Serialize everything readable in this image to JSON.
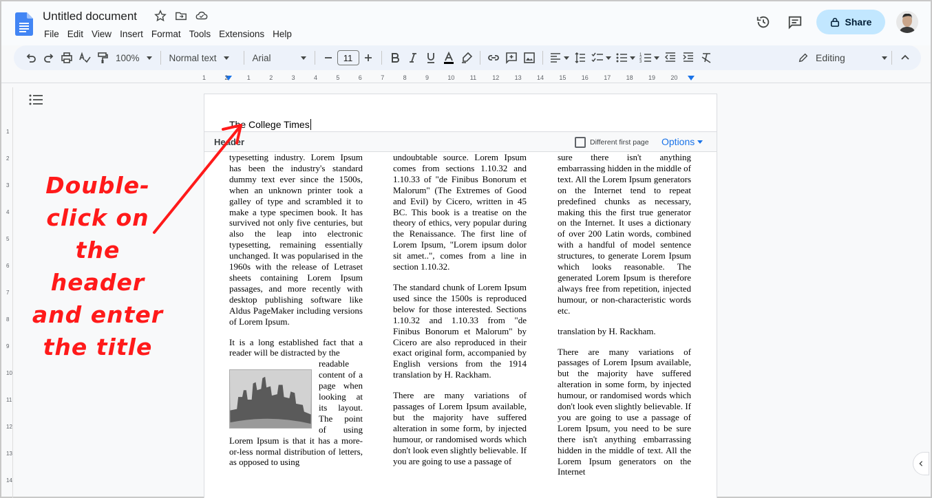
{
  "document": {
    "title": "Untitled document"
  },
  "menu": [
    "File",
    "Edit",
    "View",
    "Insert",
    "Format",
    "Tools",
    "Extensions",
    "Help"
  ],
  "toolbar": {
    "zoom": "100%",
    "style": "Normal text",
    "font": "Arial",
    "font_size": "11",
    "mode": "Editing"
  },
  "share": {
    "label": "Share"
  },
  "ruler": {
    "marks": [
      "1",
      "2",
      "1",
      "2",
      "3",
      "4",
      "5",
      "6",
      "7",
      "8",
      "9",
      "10",
      "11",
      "12",
      "13",
      "14",
      "15",
      "16",
      "17",
      "18",
      "19",
      "20"
    ]
  },
  "header": {
    "text": "The College Times",
    "label": "Header",
    "different_first_page": "Different first page",
    "options_label": "Options"
  },
  "columns": {
    "col1": {
      "p1": "typesetting industry. Lorem Ipsum has been the industry's standard dummy text ever since the 1500s, when an unknown printer took a galley of type and scrambled it to make a type specimen book. It has survived not only five centuries, but also the leap into electronic typesetting, remaining essentially unchanged. It was popularised in the 1960s with the release of Letraset sheets containing Lorem Ipsum passages, and more recently with desktop publishing software like Aldus PageMaker including versions of Lorem Ipsum.",
      "p2a": "It is a long established fact that a reader will be distracted by the",
      "p2b": "readable content of a page when looking at its layout. The point of using Lorem Ipsum is that it has a more-or-less normal distribution of letters, as opposed to using"
    },
    "col2": {
      "p1": "undoubtable source. Lorem Ipsum comes from sections 1.10.32 and 1.10.33 of \"de Finibus Bonorum et Malorum\" (The Extremes of Good and Evil) by Cicero, written in 45 BC. This book is a treatise on the theory of ethics, very popular during the Renaissance. The first line of Lorem Ipsum, \"Lorem ipsum dolor sit amet..\", comes from a line in section 1.10.32.",
      "p2": "The standard chunk of Lorem Ipsum used since the 1500s is reproduced below for those interested. Sections 1.10.32 and 1.10.33 from \"de Finibus Bonorum et Malorum\" by Cicero are also reproduced in their exact original form, accompanied by English versions from the 1914 translation by H. Rackham.",
      "p3": "There are many variations of passages of Lorem Ipsum available, but the majority have suffered alteration in some form, by injected humour, or randomised words which don't look even slightly believable. If you are going to use a passage of"
    },
    "col3": {
      "p1": "sure there isn't anything embarrassing hidden in the middle of text. All the Lorem Ipsum generators on the Internet tend to repeat predefined chunks as necessary, making this the first true generator on the Internet. It uses a dictionary of over 200 Latin words, combined with a handful of model sentence structures, to generate Lorem Ipsum which looks reasonable. The generated Lorem Ipsum is therefore always free from repetition, injected humour, or non-characteristic words etc.",
      "p2": "translation by H. Rackham.",
      "p3": "There are many variations of passages of Lorem Ipsum available, but the majority have suffered alteration in some form, by injected humour, or randomised words which don't look even slightly believable. If you are going to use a passage of Lorem Ipsum, you need to be sure there isn't anything embarrassing hidden in the middle of text. All the Lorem Ipsum generators on the Internet"
    }
  },
  "annotation": {
    "line1": "Double-",
    "line2": "click on",
    "line3": "the header",
    "line4": "and enter",
    "line5": "the title",
    "color": "#ff1a1a"
  },
  "colors": {
    "accent": "#1a73e8",
    "share_bg": "#c2e7ff",
    "toolbar_bg": "#edf2fa"
  }
}
